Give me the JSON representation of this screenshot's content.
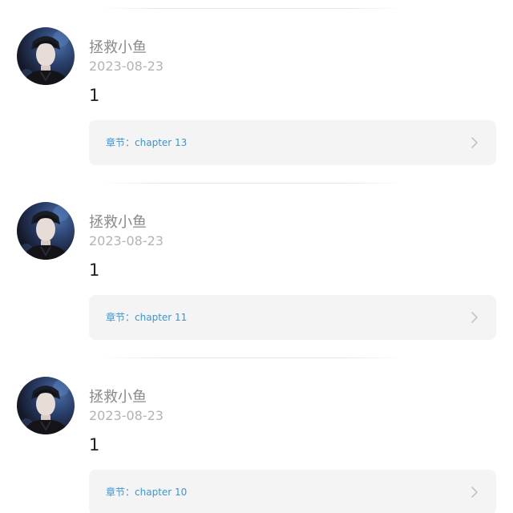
{
  "comments": [
    {
      "username": "拯救小鱼",
      "date": "2023-08-23",
      "content": "1",
      "chapter_prefix": "章节：",
      "chapter_name": "chapter 13",
      "icon": "chevron-right-icon"
    },
    {
      "username": "拯救小鱼",
      "date": "2023-08-23",
      "content": "1",
      "chapter_prefix": "章节：",
      "chapter_name": "chapter 11",
      "icon": "chevron-right-icon"
    },
    {
      "username": "拯救小鱼",
      "date": "2023-08-23",
      "content": "1",
      "chapter_prefix": "章节：",
      "chapter_name": "chapter 10",
      "icon": "chevron-right-icon"
    }
  ],
  "colors": {
    "accent": "#3a95d4",
    "username": "#8a8a8a",
    "date": "#b3b3b3",
    "card_bg": "#f4f4f4"
  }
}
